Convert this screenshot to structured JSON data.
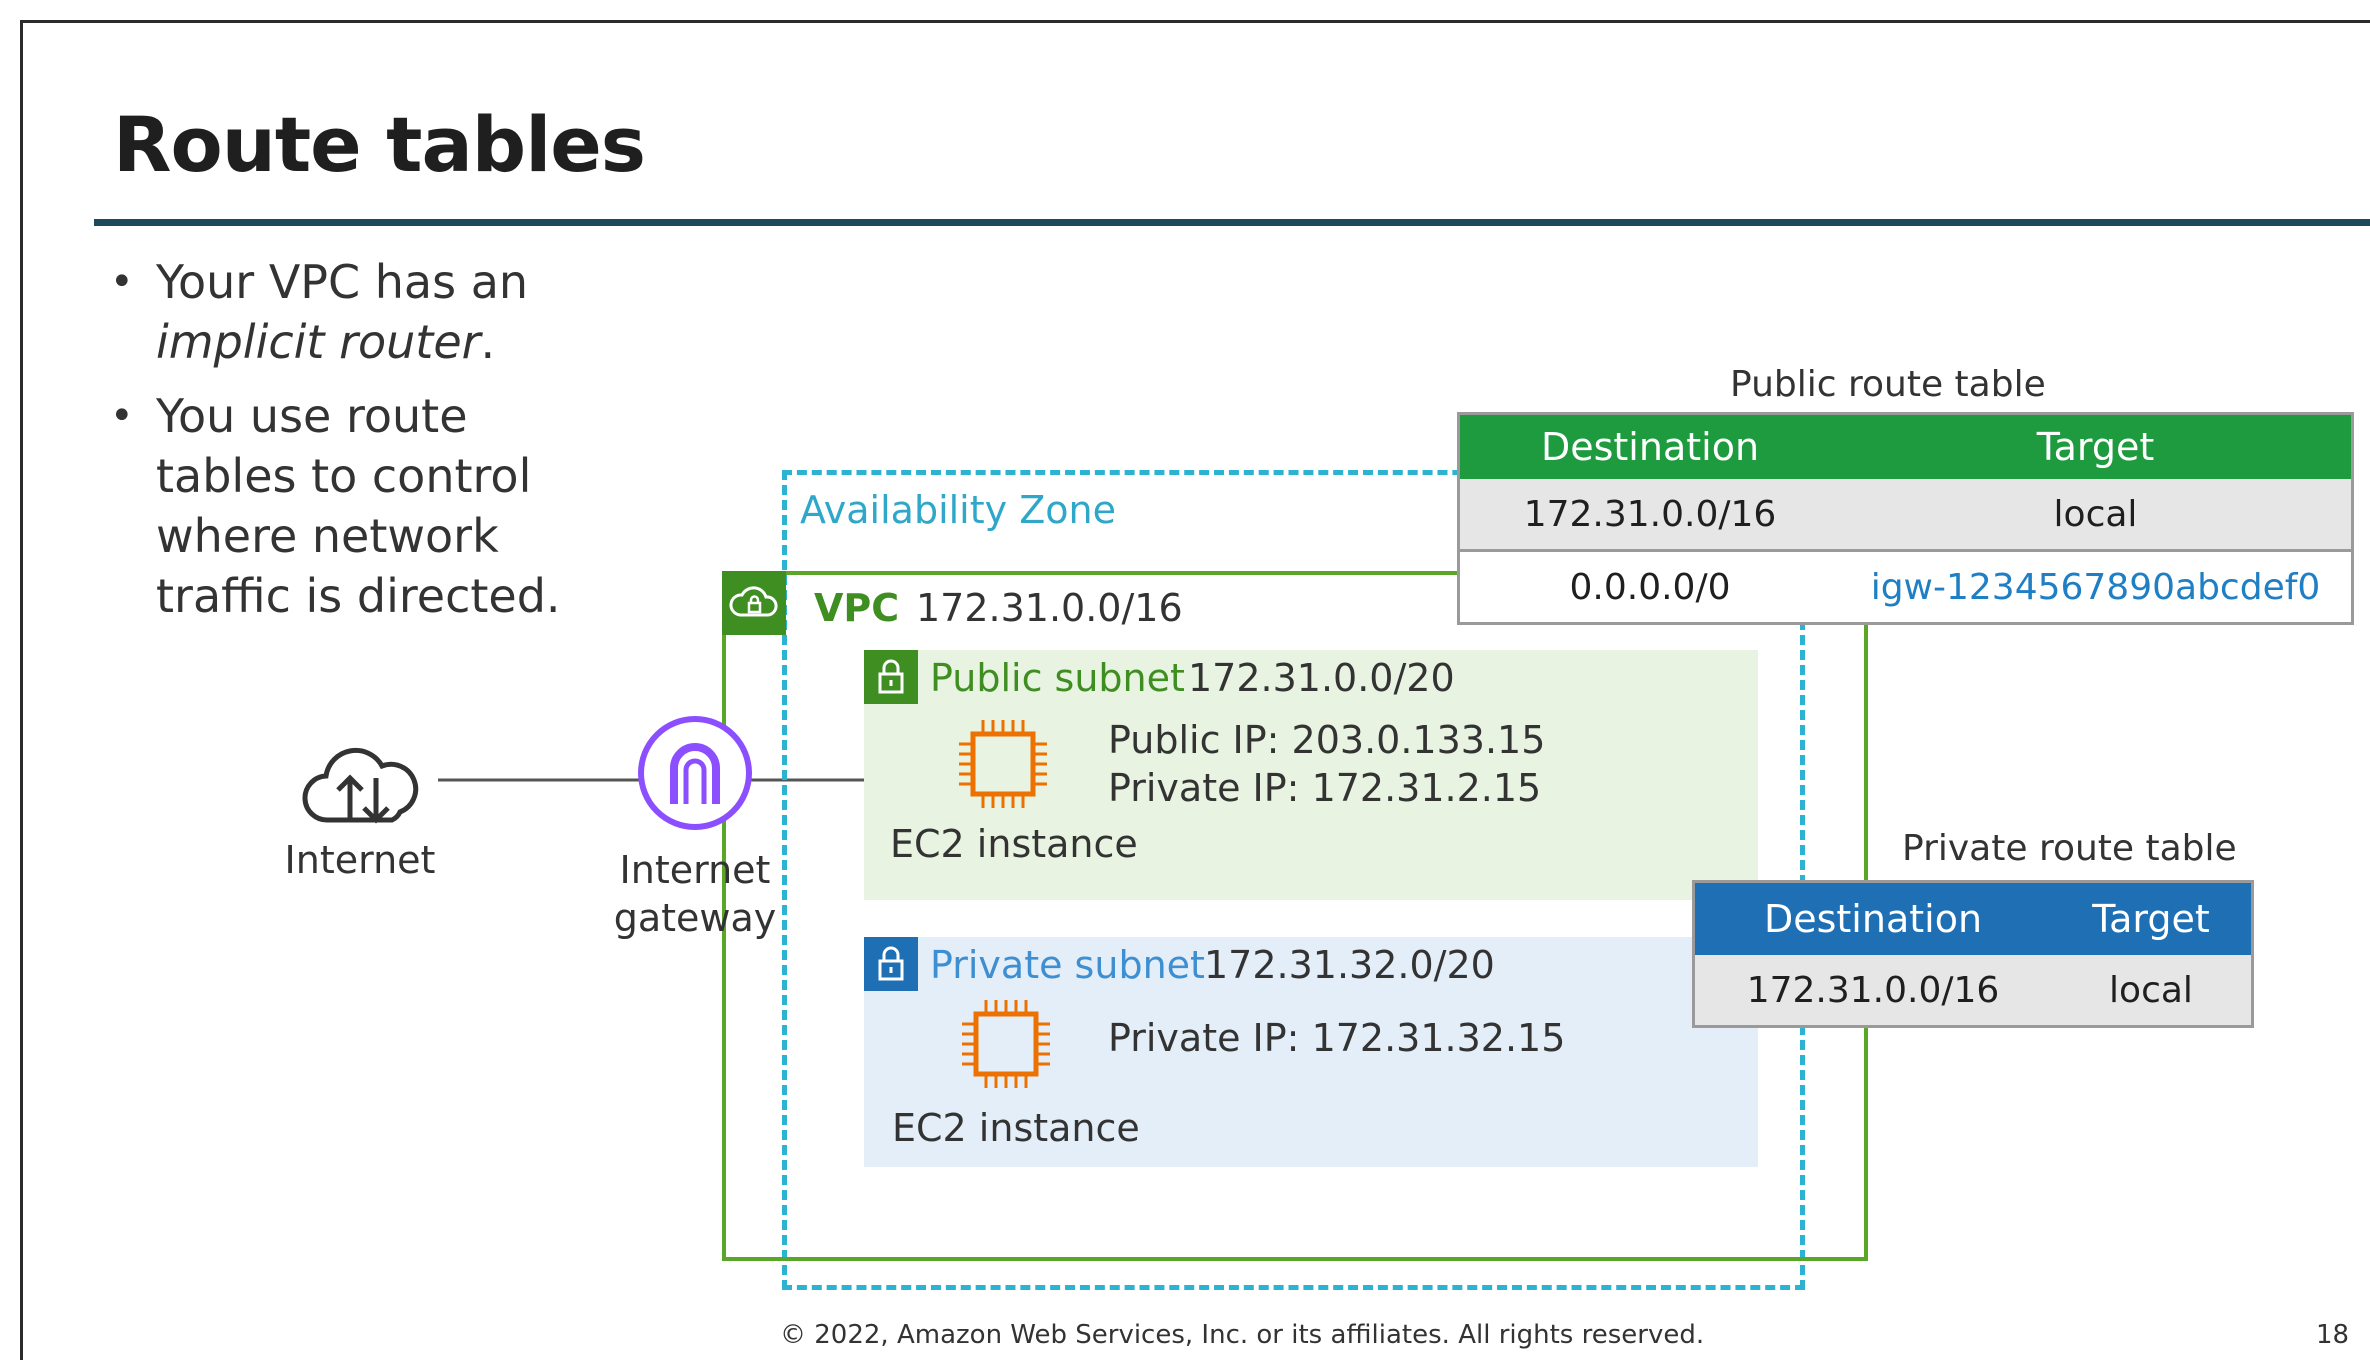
{
  "slide": {
    "title": "Route tables",
    "bullets": [
      {
        "text": "Your VPC has an ",
        "emphasis": "implicit router",
        "suffix": "."
      },
      {
        "text": "You use route tables to control where network traffic is directed."
      }
    ],
    "footer": "© 2022, Amazon Web Services, Inc. or its affiliates. All rights reserved.",
    "page_number": "18"
  },
  "diagram": {
    "internet_label": "Internet",
    "gateway_label_line1": "Internet",
    "gateway_label_line2": "gateway",
    "availability_zone_label": "Availability Zone",
    "vpc_label": "VPC",
    "vpc_cidr": "172.31.0.0/16",
    "public_subnet": {
      "label": "Public subnet",
      "cidr": "172.31.0.0/20",
      "public_ip": "Public IP:  203.0.133.15",
      "private_ip": "Private IP: 172.31.2.15",
      "instance_label": "EC2 instance"
    },
    "private_subnet": {
      "label": "Private subnet",
      "cidr": "172.31.32.0/20",
      "private_ip": "Private IP: 172.31.32.15",
      "instance_label": "EC2 instance"
    },
    "public_route_table": {
      "caption": "Public route table",
      "headers": [
        "Destination",
        "Target"
      ],
      "rows": [
        [
          "172.31.0.0/16",
          "local"
        ],
        [
          "0.0.0.0/0",
          "igw-1234567890abcdef0"
        ]
      ]
    },
    "private_route_table": {
      "caption": "Private route table",
      "headers": [
        "Destination",
        "Target"
      ],
      "rows": [
        [
          "172.31.0.0/16",
          "local"
        ]
      ]
    }
  },
  "colors": {
    "vpc_green": "#3e8e21",
    "public_green": "#1f9b3f",
    "private_blue": "#1e6fb3",
    "az_cyan": "#2bb3d1",
    "gateway_purple": "#8c4fff",
    "ec2_orange": "#ed7100",
    "title_rule": "#1c4a5c"
  },
  "icons": [
    "internet-cloud-icon",
    "internet-gateway-icon",
    "vpc-cloud-lock-icon",
    "lock-icon",
    "ec2-chip-icon"
  ]
}
